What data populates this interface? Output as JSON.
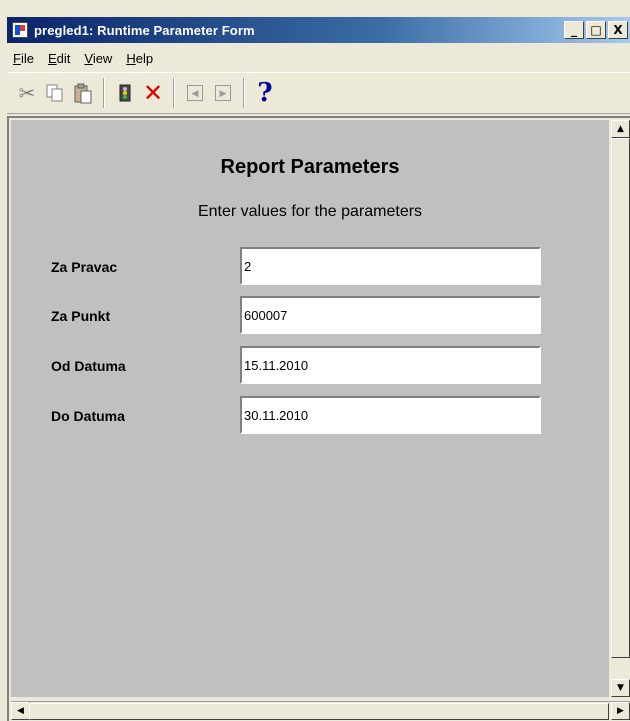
{
  "window": {
    "title": "pregled1: Runtime Parameter Form",
    "controls": {
      "minimize": "_",
      "maximize": "□",
      "close": "X"
    }
  },
  "menu": {
    "items": [
      {
        "label": "File",
        "mnemonic": "F"
      },
      {
        "label": "Edit",
        "mnemonic": "E"
      },
      {
        "label": "View",
        "mnemonic": "V"
      },
      {
        "label": "Help",
        "mnemonic": "H"
      }
    ]
  },
  "toolbar": {
    "icons": [
      "cut-icon",
      "copy-icon",
      "paste-icon",
      "run-icon",
      "cancel-icon",
      "previous-page-icon",
      "next-page-icon",
      "help-icon"
    ],
    "help_glyph": "?"
  },
  "form": {
    "heading": "Report Parameters",
    "subheading": "Enter values for the parameters",
    "fields": [
      {
        "label": "Za Pravac",
        "value": "2"
      },
      {
        "label": "Za Punkt",
        "value": "600007"
      },
      {
        "label": "Od Datuma",
        "value": "15.11.2010"
      },
      {
        "label": "Do Datuma",
        "value": "30.11.2010"
      }
    ]
  },
  "colors": {
    "title_bar": "#0A246A",
    "canvas": "#C0C0C0",
    "chrome": "#ECE9D8",
    "cancel_red": "#E00000",
    "help_blue": "#0000A0"
  }
}
